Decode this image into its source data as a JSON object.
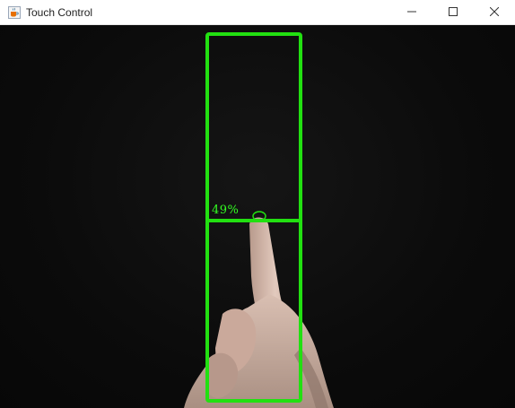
{
  "window": {
    "title": "Touch Control",
    "controls": [
      "minimize",
      "maximize",
      "close"
    ]
  },
  "overlay": {
    "percent_label": "49%",
    "level": 0.49,
    "color": "#22dd11"
  },
  "icons": {
    "app": "java-coffee-cup-icon",
    "minimize": "minimize-icon",
    "maximize": "maximize-icon",
    "close": "close-icon",
    "touch_point": "touch-point-icon"
  }
}
